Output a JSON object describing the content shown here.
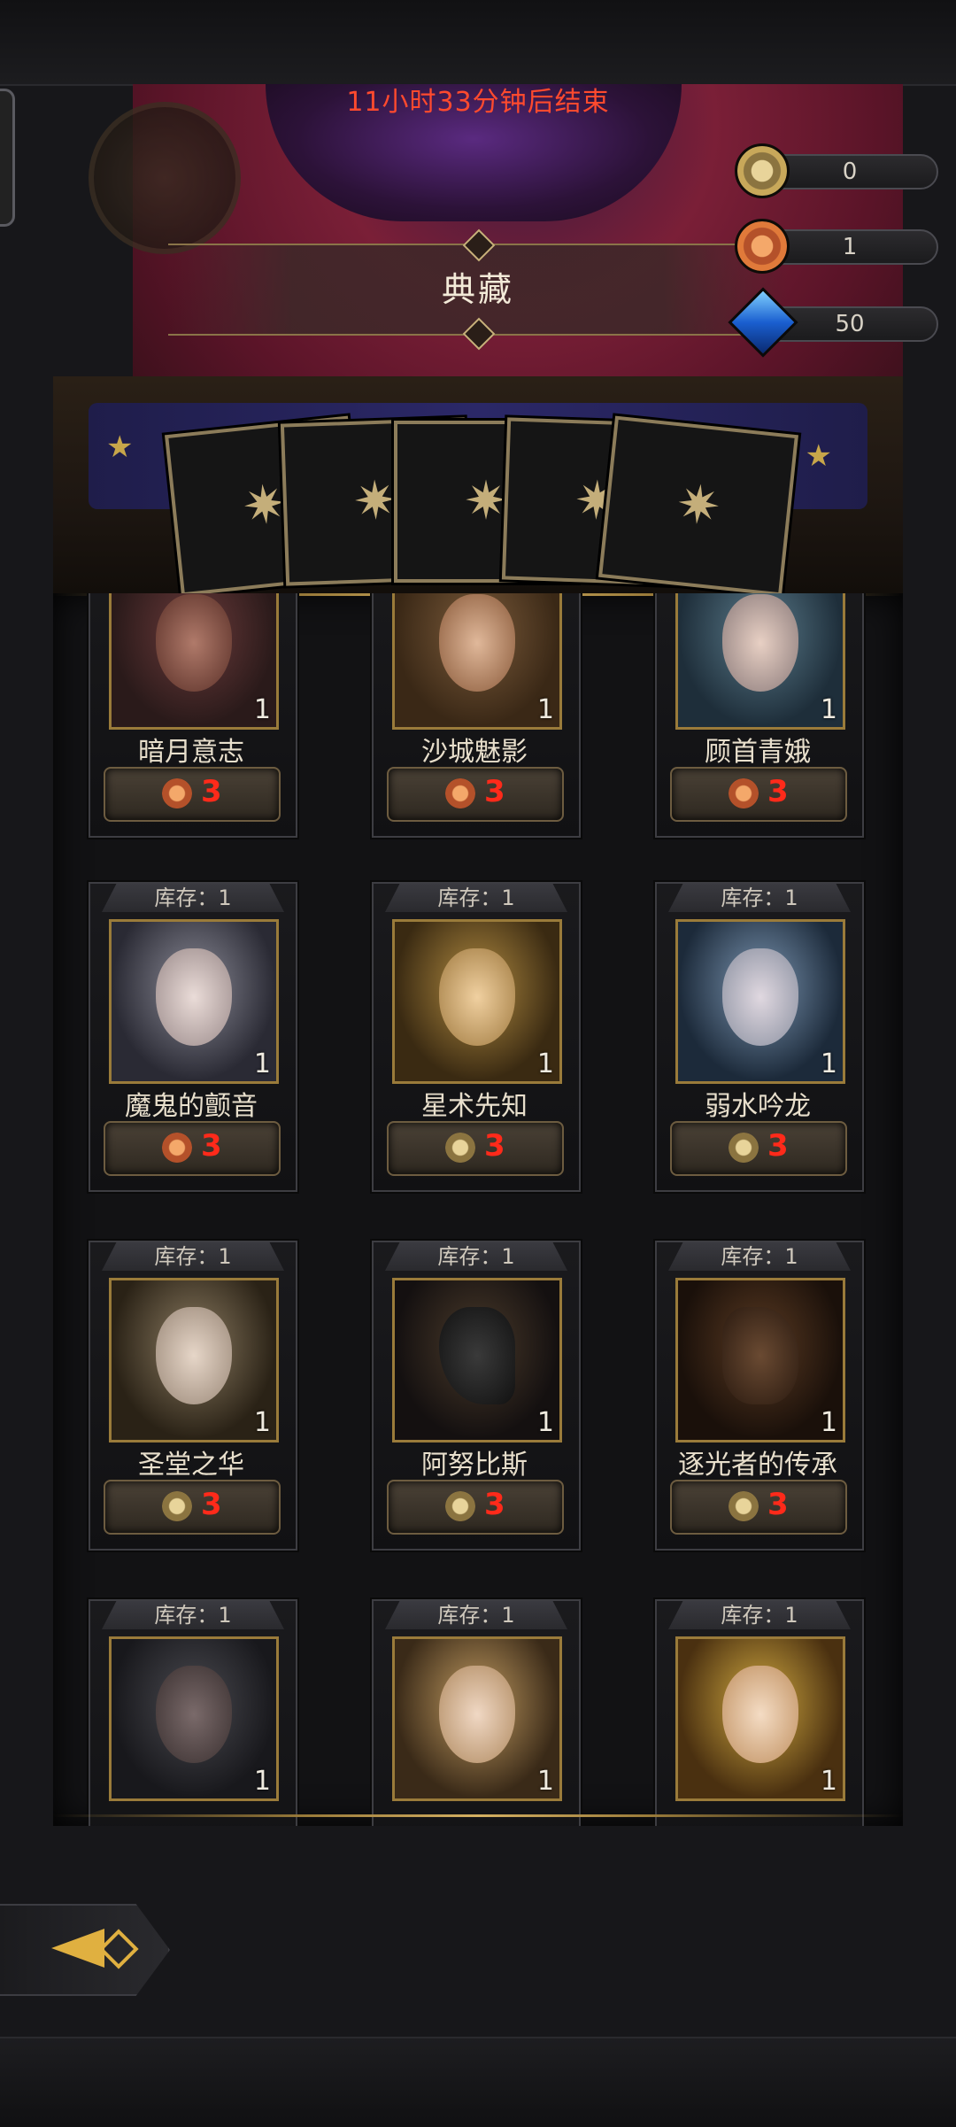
{
  "banner": {
    "timer_text": "11小时33分钟后结束",
    "title": "典藏"
  },
  "currencies": [
    {
      "icon": "gold-coin-icon",
      "value": "0"
    },
    {
      "icon": "copper-coin-icon",
      "value": "1"
    },
    {
      "icon": "blue-gem-icon",
      "value": "50"
    }
  ],
  "deck": {
    "card_icon": "compass-star-icon",
    "card_count": 5
  },
  "items": [
    {
      "stock": "",
      "name": "暗月意志",
      "count": "1",
      "price": "3",
      "currency": "copper-coin-icon"
    },
    {
      "stock": "",
      "name": "沙城魅影",
      "count": "1",
      "price": "3",
      "currency": "copper-coin-icon"
    },
    {
      "stock": "",
      "name": "顾首青娥",
      "count": "1",
      "price": "3",
      "currency": "copper-coin-icon"
    },
    {
      "stock": "库存：1",
      "name": "魔鬼的颤音",
      "count": "1",
      "price": "3",
      "currency": "copper-coin-icon"
    },
    {
      "stock": "库存：1",
      "name": "星术先知",
      "count": "1",
      "price": "3",
      "currency": "gold-coin-icon"
    },
    {
      "stock": "库存：1",
      "name": "弱水吟龙",
      "count": "1",
      "price": "3",
      "currency": "gold-coin-icon"
    },
    {
      "stock": "库存：1",
      "name": "圣堂之华",
      "count": "1",
      "price": "3",
      "currency": "gold-coin-icon"
    },
    {
      "stock": "库存：1",
      "name": "阿努比斯",
      "count": "1",
      "price": "3",
      "currency": "gold-coin-icon"
    },
    {
      "stock": "库存：1",
      "name": "逐光者的传承",
      "count": "1",
      "price": "3",
      "currency": "gold-coin-icon"
    },
    {
      "stock": "库存：1",
      "name": "",
      "count": "1",
      "price": "",
      "currency": ""
    },
    {
      "stock": "库存：1",
      "name": "",
      "count": "1",
      "price": "",
      "currency": ""
    },
    {
      "stock": "库存：1",
      "name": "",
      "count": "1",
      "price": "",
      "currency": ""
    }
  ],
  "nav": {
    "back_icon": "back-arrow-icon"
  },
  "colors": {
    "price_red": "#ff2a1a",
    "timer_red": "#ff4a2e",
    "frame_gold": "#9a7b3a"
  }
}
